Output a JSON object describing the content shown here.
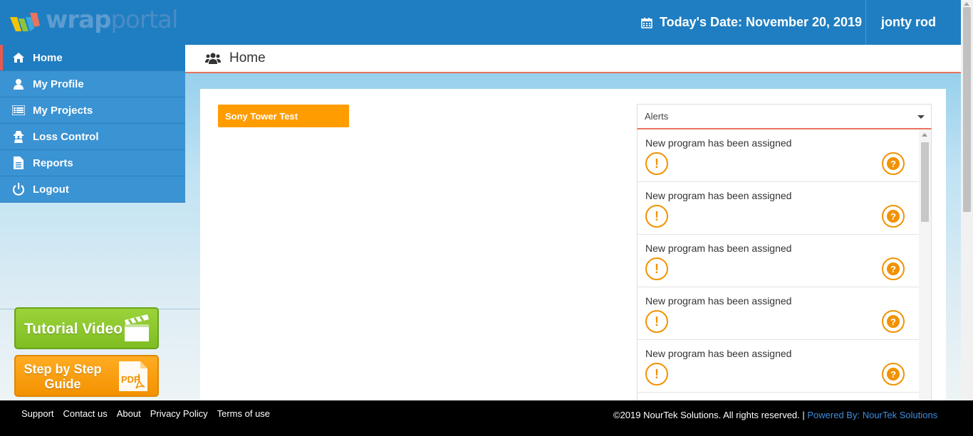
{
  "header": {
    "logo_text_bold": "wrap",
    "logo_text_thin": "portal",
    "date_label": "Today's Date: November 20, 2019",
    "user_name": "jonty rod"
  },
  "sidebar": {
    "items": [
      {
        "label": "Home",
        "icon": "home-icon",
        "active": true
      },
      {
        "label": "My Profile",
        "icon": "user-icon"
      },
      {
        "label": "My Projects",
        "icon": "list-icon"
      },
      {
        "label": "Loss Control",
        "icon": "spy-icon"
      },
      {
        "label": "Reports",
        "icon": "document-icon"
      },
      {
        "label": "Logout",
        "icon": "power-icon"
      }
    ]
  },
  "page": {
    "title": "Home",
    "title_icon": "users-icon"
  },
  "project_button": "Sony Tower Test",
  "alerts": {
    "header": "Alerts",
    "items": [
      {
        "text": "New program has been assigned"
      },
      {
        "text": "New program has been assigned"
      },
      {
        "text": "New program has been assigned"
      },
      {
        "text": "New program has been assigned"
      },
      {
        "text": "New program has been assigned"
      },
      {
        "text": ""
      }
    ]
  },
  "promo": {
    "tutorial_label": "Tutorial Video",
    "guide_label": "Step by Step Guide",
    "pdf_label": "PDF"
  },
  "footer": {
    "links": [
      "Support",
      "Contact us",
      "About",
      "Privacy Policy",
      "Terms of use"
    ],
    "copyright": "©2019 NourTek Solutions. All rights reserved. |",
    "powered": "Powered By: NourTek Solutions"
  },
  "colors": {
    "header_blue": "#1f7ec1",
    "nav_blue": "#3a93d3",
    "accent_orange": "#ff9c00",
    "accent_red": "#e8735f",
    "green": "#8bc53f"
  }
}
